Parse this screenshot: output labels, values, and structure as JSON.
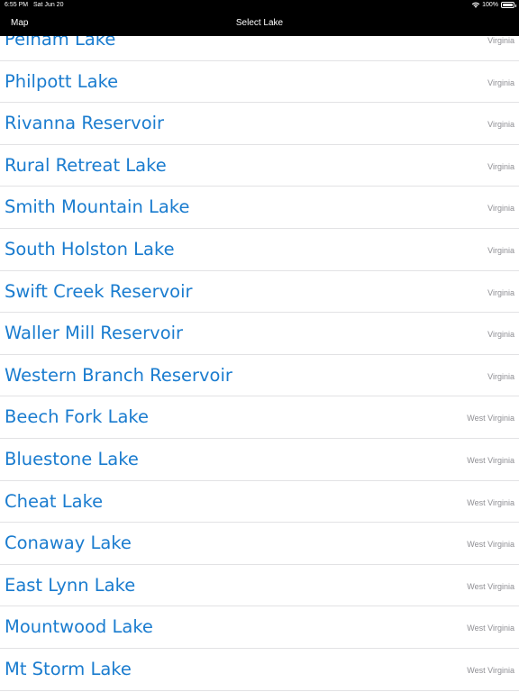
{
  "status_bar": {
    "time": "6:55 PM",
    "date": "Sat Jun 20",
    "battery": "100%",
    "battery_level": 1.0,
    "icons": [
      "wifi-icon",
      "battery-icon"
    ]
  },
  "nav": {
    "back_label": "Map",
    "title": "Select Lake"
  },
  "lakes": [
    {
      "name": "Pelham Lake",
      "state": "Virginia"
    },
    {
      "name": "Philpott Lake",
      "state": "Virginia"
    },
    {
      "name": "Rivanna Reservoir",
      "state": "Virginia"
    },
    {
      "name": "Rural Retreat Lake",
      "state": "Virginia"
    },
    {
      "name": "Smith Mountain Lake",
      "state": "Virginia"
    },
    {
      "name": "South Holston Lake",
      "state": "Virginia"
    },
    {
      "name": "Swift Creek Reservoir",
      "state": "Virginia"
    },
    {
      "name": "Waller Mill Reservoir",
      "state": "Virginia"
    },
    {
      "name": "Western Branch Reservoir",
      "state": "Virginia"
    },
    {
      "name": "Beech Fork Lake",
      "state": "West Virginia"
    },
    {
      "name": "Bluestone Lake",
      "state": "West Virginia"
    },
    {
      "name": "Cheat Lake",
      "state": "West Virginia"
    },
    {
      "name": "Conaway Lake",
      "state": "West Virginia"
    },
    {
      "name": "East Lynn Lake",
      "state": "West Virginia"
    },
    {
      "name": "Mountwood Lake",
      "state": "West Virginia"
    },
    {
      "name": "Mt Storm Lake",
      "state": "West Virginia"
    }
  ],
  "colors": {
    "lake_name": "#1a7ccf",
    "state_label": "#8e8e93",
    "bar_background": "#000000",
    "separator": "#e2e2e4"
  }
}
